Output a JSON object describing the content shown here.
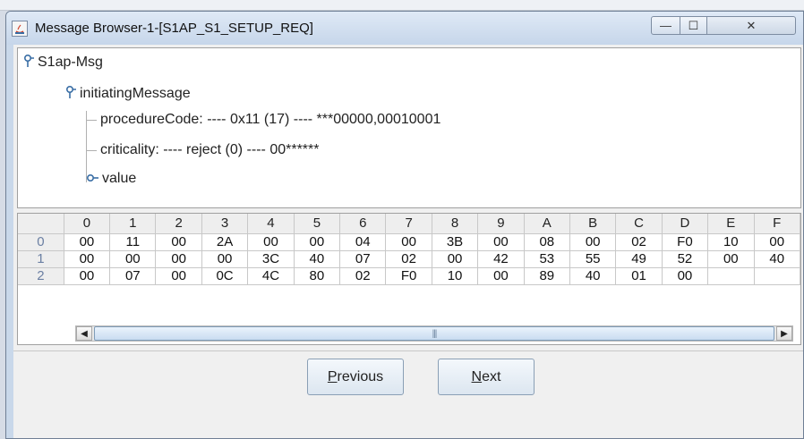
{
  "window": {
    "title": "Message Browser-1-[S1AP_S1_SETUP_REQ]",
    "controls": {
      "minimize": "—",
      "maximize": "☐",
      "close": "✕"
    }
  },
  "tree": {
    "root": "S1ap-Msg",
    "child": "initiatingMessage",
    "procedureCode": "procedureCode: ---- 0x11 (17) ---- ***00000,00010001",
    "criticality": "criticality: ---- reject (0) ---- 00******",
    "value": "value"
  },
  "hex_table": {
    "columns": [
      "0",
      "1",
      "2",
      "3",
      "4",
      "5",
      "6",
      "7",
      "8",
      "9",
      "A",
      "B",
      "C",
      "D",
      "E",
      "F"
    ],
    "rows": [
      {
        "label": "0",
        "cells": [
          "00",
          "11",
          "00",
          "2A",
          "00",
          "00",
          "04",
          "00",
          "3B",
          "00",
          "08",
          "00",
          "02",
          "F0",
          "10",
          "00"
        ]
      },
      {
        "label": "1",
        "cells": [
          "00",
          "00",
          "00",
          "00",
          "3C",
          "40",
          "07",
          "02",
          "00",
          "42",
          "53",
          "55",
          "49",
          "52",
          "00",
          "40"
        ]
      },
      {
        "label": "2",
        "cells": [
          "00",
          "07",
          "00",
          "0C",
          "4C",
          "80",
          "02",
          "F0",
          "10",
          "00",
          "89",
          "40",
          "01",
          "00",
          "",
          ""
        ]
      }
    ]
  },
  "scrollbar": {
    "left_arrow": "◀",
    "right_arrow": "▶",
    "grip": "|||"
  },
  "buttons": {
    "previous": {
      "accel": "P",
      "rest": "revious"
    },
    "next": {
      "accel": "N",
      "rest": "ext"
    }
  },
  "colors": {
    "title_bg": "#c9d8ea",
    "tree_knob": "#3a6ea5"
  }
}
